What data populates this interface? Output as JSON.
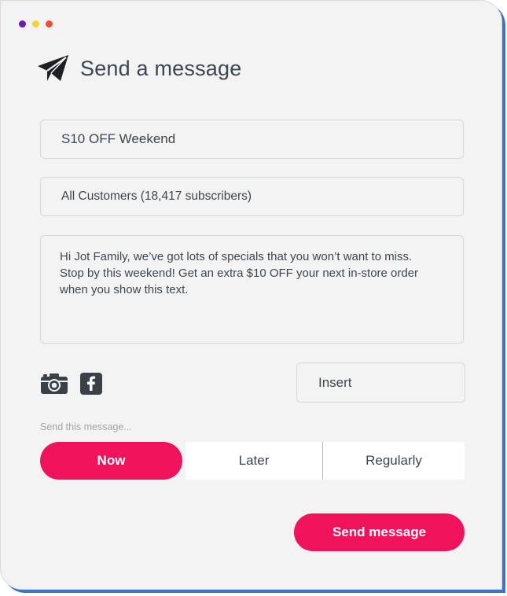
{
  "window": {
    "controls": [
      {
        "name": "window-dot-purple",
        "color": "#6a1ab5"
      },
      {
        "name": "window-dot-yellow",
        "color": "#f6d232"
      },
      {
        "name": "window-dot-red",
        "color": "#f14d3a"
      }
    ]
  },
  "header": {
    "icon": "paper-plane-icon",
    "title": "Send a message"
  },
  "form": {
    "campaign_name": "S10 OFF Weekend",
    "audience": "All Customers (18,417 subscribers)",
    "message_lines": [
      "Hi Jot Family, we’ve got lots of specials that you won’t want to miss.",
      "Stop by this weekend! Get an extra $10 OFF your next in-store order",
      "when you show this text."
    ]
  },
  "attachments": {
    "icons": [
      "camera-icon",
      "facebook-icon"
    ],
    "insert_label": "Insert"
  },
  "schedule": {
    "label": "Send this message...",
    "options": [
      "Now",
      "Later",
      "Regularly"
    ],
    "selected": "Now"
  },
  "actions": {
    "send_label": "Send message"
  },
  "colors": {
    "accent": "#f0125b",
    "frame_shadow": "#3b73c8",
    "panel_background": "#f3f3f3",
    "text": "#3c4650"
  }
}
